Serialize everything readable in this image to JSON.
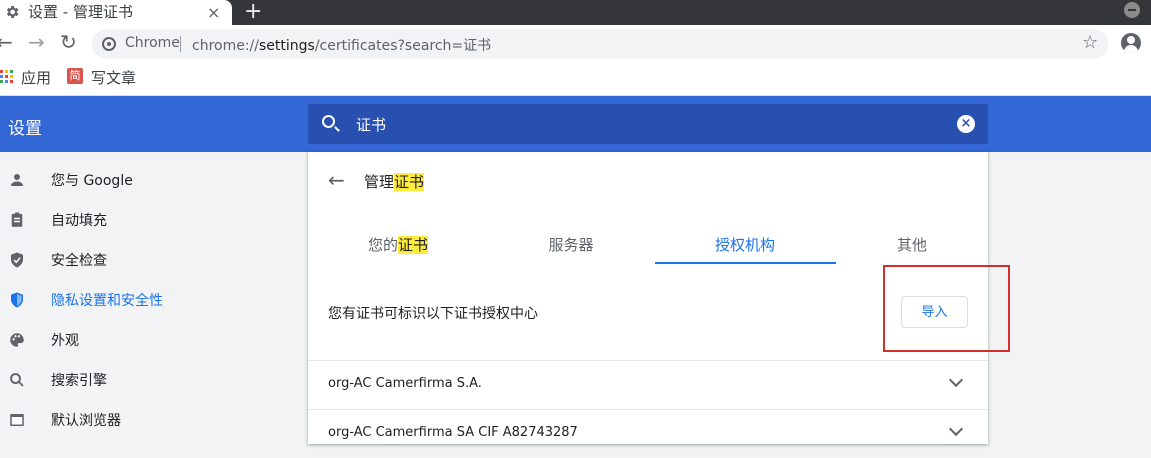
{
  "browser": {
    "tab_title": "设置 - 管理证书",
    "tab_close": "×",
    "new_tab": "+",
    "back_glyph": "←",
    "forward_glyph": "→",
    "reload_glyph": "↻",
    "omnibox_label": "Chrome",
    "url_prefix": "chrome://",
    "url_host": "settings",
    "url_path": "/certificates?search=证书",
    "star_glyph": "☆"
  },
  "bookmarks": {
    "apps_label": "应用",
    "jian_badge": "简",
    "write_label": "写文章"
  },
  "settings": {
    "title": "设置",
    "search_value": "证书",
    "clear_glyph": "×",
    "sidebar": [
      {
        "label": "您与 Google",
        "icon": "person-icon"
      },
      {
        "label": "自动填充",
        "icon": "clipboard-icon"
      },
      {
        "label": "安全检查",
        "icon": "shield-check-icon"
      },
      {
        "label": "隐私设置和安全性",
        "icon": "shield-icon",
        "active": true
      },
      {
        "label": "外观",
        "icon": "palette-icon"
      },
      {
        "label": "搜索引擎",
        "icon": "search-icon"
      },
      {
        "label": "默认浏览器",
        "icon": "browser-icon"
      }
    ]
  },
  "card": {
    "back_glyph": "←",
    "title_pre": "管理",
    "title_mark": "证书",
    "tabs": {
      "yours_pre": "您的",
      "yours_mark": "证书",
      "servers": "服务器",
      "authorities": "授权机构",
      "others": "其他"
    },
    "description": "您有证书可标识以下证书授权中心",
    "import_label": "导入",
    "rows": [
      "org-AC Camerfirma S.A.",
      "org-AC Camerfirma SA CIF A82743287"
    ]
  },
  "colors": {
    "accent": "#1a73e8",
    "header": "#3367d6",
    "highlight": "#ffeb3b",
    "annotation": "#d32f2f"
  }
}
